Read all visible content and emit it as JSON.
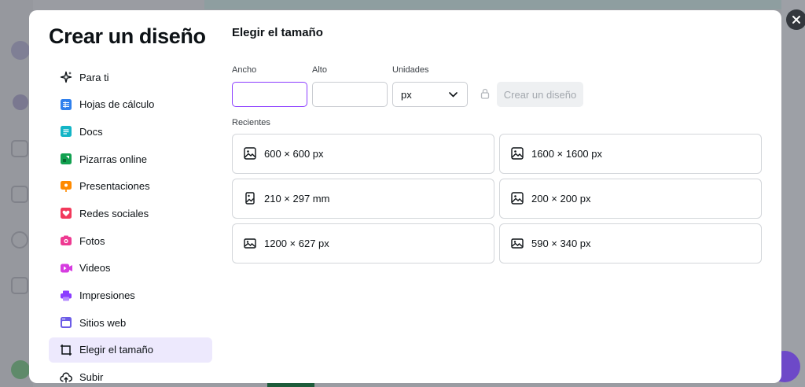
{
  "modal": {
    "title": "Crear un diseño",
    "close_icon": "close-icon"
  },
  "nav": {
    "items": [
      {
        "label": "Para ti",
        "icon": "sparkle-icon",
        "color": "#0d1216"
      },
      {
        "label": "Hojas de cálculo",
        "icon": "spreadsheet-icon",
        "color": "#2f80ed"
      },
      {
        "label": "Docs",
        "icon": "docs-icon",
        "color": "#13b5c6"
      },
      {
        "label": "Pizarras online",
        "icon": "whiteboard-icon",
        "color": "#12a150"
      },
      {
        "label": "Presentaciones",
        "icon": "presentation-icon",
        "color": "#ff8a00"
      },
      {
        "label": "Redes sociales",
        "icon": "heart-icon",
        "color": "#f2395b"
      },
      {
        "label": "Fotos",
        "icon": "camera-icon",
        "color": "#ee3a92"
      },
      {
        "label": "Videos",
        "icon": "video-icon",
        "color": "#d63ce0"
      },
      {
        "label": "Impresiones",
        "icon": "printer-icon",
        "color": "#8b3dff"
      },
      {
        "label": "Sitios web",
        "icon": "website-icon",
        "color": "#6c5ce7"
      },
      {
        "label": "Elegir el tamaño",
        "icon": "resize-icon",
        "color": "#0d1216",
        "active": true
      },
      {
        "label": "Subir",
        "icon": "upload-icon",
        "color": "#0d1216"
      }
    ]
  },
  "size_form": {
    "title": "Elegir el tamaño",
    "width_label": "Ancho",
    "width_value": "",
    "height_label": "Alto",
    "height_value": "",
    "units_label": "Unidades",
    "units_value": "px",
    "create_label": "Crear un diseño"
  },
  "recents": {
    "label": "Recientes",
    "items": [
      {
        "label": "600 × 600 px",
        "icon": "image-icon"
      },
      {
        "label": "1600 × 1600 px",
        "icon": "image-icon"
      },
      {
        "label": "210 × 297 mm",
        "icon": "portrait-image-icon"
      },
      {
        "label": "200 × 200 px",
        "icon": "image-icon"
      },
      {
        "label": "1200 × 627 px",
        "icon": "landscape-image-icon"
      },
      {
        "label": "590 × 340 px",
        "icon": "landscape-image-icon"
      }
    ]
  },
  "colors": {
    "accent": "#8b3dff",
    "active_bg": "#ede9fd"
  }
}
